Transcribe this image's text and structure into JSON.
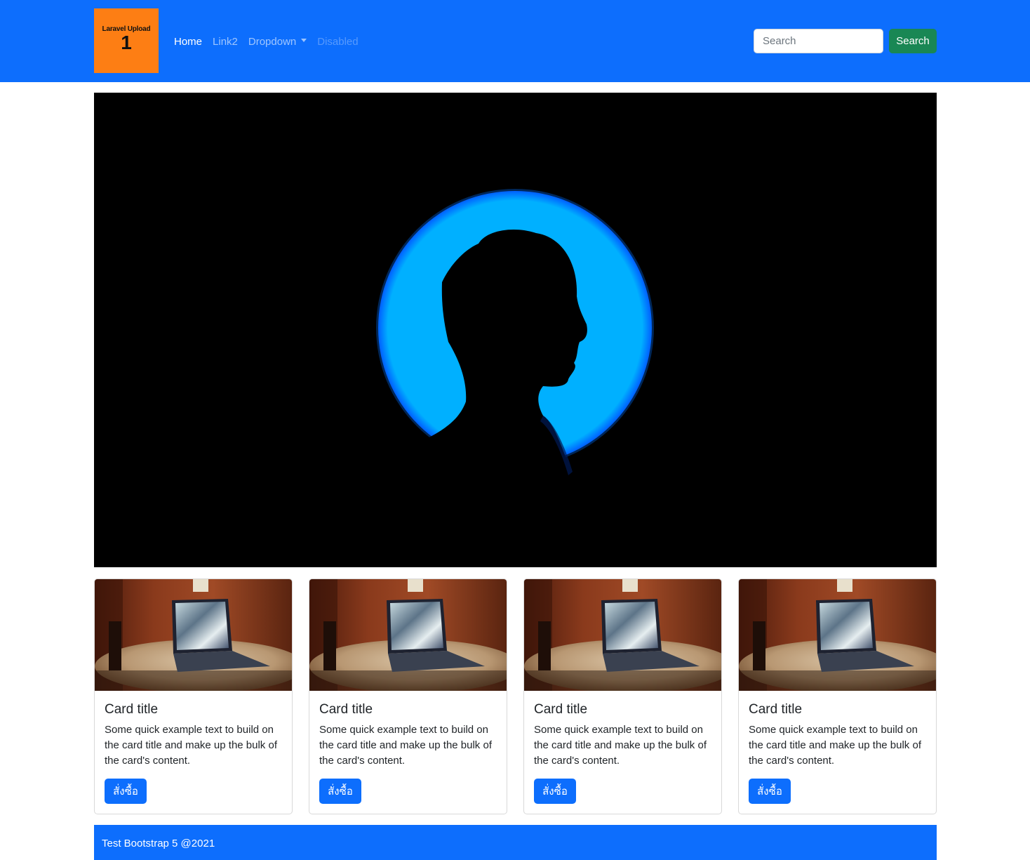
{
  "navbar": {
    "background": "#0d6efd",
    "logo": {
      "text": "Laravel Upload",
      "number": "1",
      "background": "#fd7e14"
    },
    "links": [
      {
        "label": "Home",
        "state": "active"
      },
      {
        "label": "Link2",
        "state": "normal"
      },
      {
        "label": "Dropdown",
        "state": "dropdown"
      },
      {
        "label": "Disabled",
        "state": "disabled"
      }
    ],
    "search": {
      "placeholder": "Search",
      "value": "",
      "button_label": "Search",
      "button_color": "#198754"
    }
  },
  "hero": {
    "image": "silhouette-profile-blue-circle",
    "circle_color": "#00b0ff"
  },
  "cards": [
    {
      "image": "laptop-on-table-photo",
      "title": "Card title",
      "text": "Some quick example text to build on the card title and make up the bulk of the card's content.",
      "button_label": "สั่งซื้อ"
    },
    {
      "image": "laptop-on-table-photo",
      "title": "Card title",
      "text": "Some quick example text to build on the card title and make up the bulk of the card's content.",
      "button_label": "สั่งซื้อ"
    },
    {
      "image": "laptop-on-table-photo",
      "title": "Card title",
      "text": "Some quick example text to build on the card title and make up the bulk of the card's content.",
      "button_label": "สั่งซื้อ"
    },
    {
      "image": "laptop-on-table-photo",
      "title": "Card title",
      "text": "Some quick example text to build on the card title and make up the bulk of the card's content.",
      "button_label": "สั่งซื้อ"
    }
  ],
  "footer": {
    "text": "Test Bootstrap 5 @2021"
  }
}
